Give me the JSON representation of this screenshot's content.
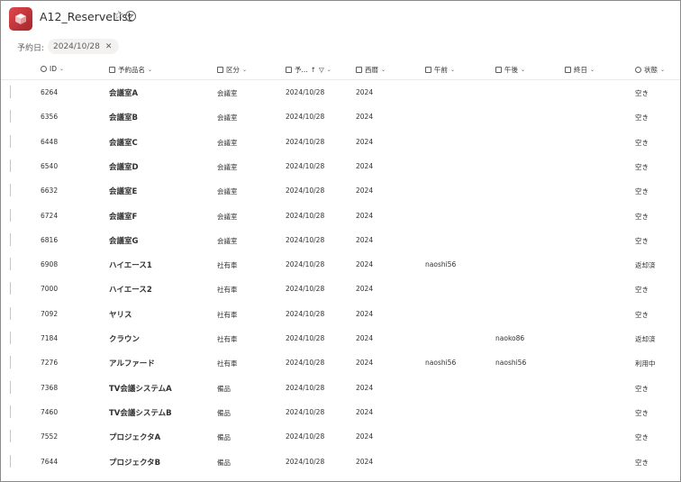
{
  "header": {
    "title": "A12_ReserveList",
    "star_icon": "star-icon",
    "check_icon": "check-circle-icon"
  },
  "filter": {
    "label": "予約日:",
    "value": "2024/10/28",
    "close": "✕"
  },
  "columns": [
    {
      "label": "ID",
      "icon": "id-icon"
    },
    {
      "label": "予約品名",
      "icon": "text-icon"
    },
    {
      "label": "区分",
      "icon": "text-icon"
    },
    {
      "label": "予...",
      "icon": "calendar-icon"
    },
    {
      "label": "西暦",
      "icon": "text-icon"
    },
    {
      "label": "午前",
      "icon": "text-icon"
    },
    {
      "label": "午後",
      "icon": "text-icon"
    },
    {
      "label": "終日",
      "icon": "text-icon"
    },
    {
      "label": "状態",
      "icon": "status-icon"
    }
  ],
  "rows": [
    {
      "id": "6264",
      "name": "会議室A",
      "category": "会議室",
      "date": "2024/10/28",
      "year": "2024",
      "am": "",
      "pm": "",
      "allday": "",
      "status": "空き"
    },
    {
      "id": "6356",
      "name": "会議室B",
      "category": "会議室",
      "date": "2024/10/28",
      "year": "2024",
      "am": "",
      "pm": "",
      "allday": "",
      "status": "空き"
    },
    {
      "id": "6448",
      "name": "会議室C",
      "category": "会議室",
      "date": "2024/10/28",
      "year": "2024",
      "am": "",
      "pm": "",
      "allday": "",
      "status": "空き"
    },
    {
      "id": "6540",
      "name": "会議室D",
      "category": "会議室",
      "date": "2024/10/28",
      "year": "2024",
      "am": "",
      "pm": "",
      "allday": "",
      "status": "空き"
    },
    {
      "id": "6632",
      "name": "会議室E",
      "category": "会議室",
      "date": "2024/10/28",
      "year": "2024",
      "am": "",
      "pm": "",
      "allday": "",
      "status": "空き"
    },
    {
      "id": "6724",
      "name": "会議室F",
      "category": "会議室",
      "date": "2024/10/28",
      "year": "2024",
      "am": "",
      "pm": "",
      "allday": "",
      "status": "空き"
    },
    {
      "id": "6816",
      "name": "会議室G",
      "category": "会議室",
      "date": "2024/10/28",
      "year": "2024",
      "am": "",
      "pm": "",
      "allday": "",
      "status": "空き"
    },
    {
      "id": "6908",
      "name": "ハイエース1",
      "category": "社有車",
      "date": "2024/10/28",
      "year": "2024",
      "am": "naoshi56",
      "pm": "",
      "allday": "",
      "status": "返却済"
    },
    {
      "id": "7000",
      "name": "ハイエース2",
      "category": "社有車",
      "date": "2024/10/28",
      "year": "2024",
      "am": "",
      "pm": "",
      "allday": "",
      "status": "空き"
    },
    {
      "id": "7092",
      "name": "ヤリス",
      "category": "社有車",
      "date": "2024/10/28",
      "year": "2024",
      "am": "",
      "pm": "",
      "allday": "",
      "status": "空き"
    },
    {
      "id": "7184",
      "name": "クラウン",
      "category": "社有車",
      "date": "2024/10/28",
      "year": "2024",
      "am": "",
      "pm": "naoko86",
      "allday": "",
      "status": "返却済"
    },
    {
      "id": "7276",
      "name": "アルファード",
      "category": "社有車",
      "date": "2024/10/28",
      "year": "2024",
      "am": "naoshi56",
      "pm": "naoshi56",
      "allday": "",
      "status": "利用中"
    },
    {
      "id": "7368",
      "name": "TV会議システムA",
      "category": "備品",
      "date": "2024/10/28",
      "year": "2024",
      "am": "",
      "pm": "",
      "allday": "",
      "status": "空き"
    },
    {
      "id": "7460",
      "name": "TV会議システムB",
      "category": "備品",
      "date": "2024/10/28",
      "year": "2024",
      "am": "",
      "pm": "",
      "allday": "",
      "status": "空き"
    },
    {
      "id": "7552",
      "name": "プロジェクタA",
      "category": "備品",
      "date": "2024/10/28",
      "year": "2024",
      "am": "",
      "pm": "",
      "allday": "",
      "status": "空き"
    },
    {
      "id": "7644",
      "name": "プロジェクタB",
      "category": "備品",
      "date": "2024/10/28",
      "year": "2024",
      "am": "",
      "pm": "",
      "allday": "",
      "status": "空き"
    }
  ]
}
